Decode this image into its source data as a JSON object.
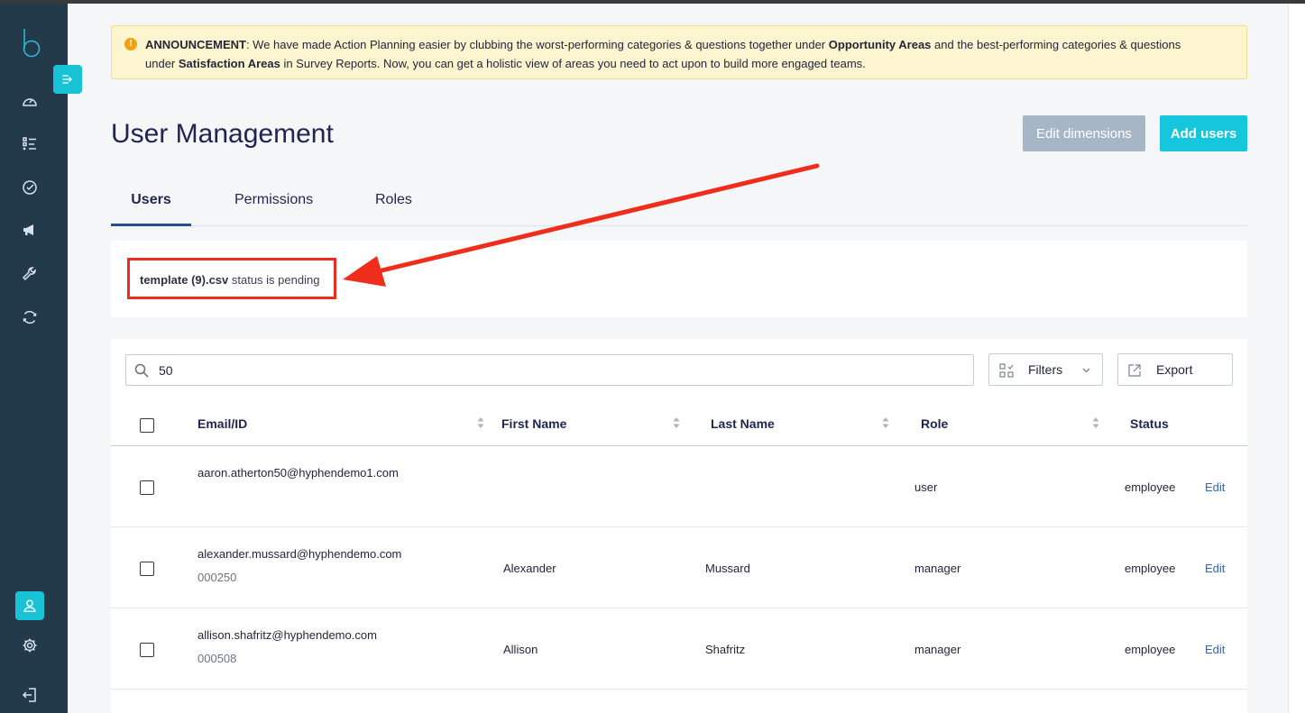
{
  "announcement": {
    "label": "ANNOUNCEMENT",
    "text_1": ": We have made Action Planning easier by clubbing the worst-performing categories & questions  together under ",
    "bold_1": "Opportunity Areas",
    "text_2": " and the best-performing  categories & questions under ",
    "bold_2": "Satisfaction Areas",
    "text_3": " in Survey Reports.  Now, you can get a holistic view of areas you need to act upon to build more engaged teams."
  },
  "page": {
    "title": "User Management",
    "edit_dimensions_label": "Edit dimensions",
    "add_users_label": "Add users"
  },
  "tabs": [
    {
      "label": "Users",
      "active": true
    },
    {
      "label": "Permissions",
      "active": false
    },
    {
      "label": "Roles",
      "active": false
    }
  ],
  "upload_status": {
    "filename": "template (9).csv",
    "message": " status is pending"
  },
  "toolbar": {
    "search_value": "50",
    "filters_label": "Filters",
    "export_label": "Export"
  },
  "table": {
    "columns": [
      "Email/ID",
      "First Name",
      "Last Name",
      "Role",
      "Status"
    ],
    "rows": [
      {
        "email": "aaron.atherton50@hyphendemo1.com",
        "id": "",
        "first_name": "",
        "last_name": "",
        "role": "user",
        "status": "employee",
        "action": "Edit"
      },
      {
        "email": "alexander.mussard@hyphendemo.com",
        "id": "000250",
        "first_name": "Alexander",
        "last_name": "Mussard",
        "role": "manager",
        "status": "employee",
        "action": "Edit"
      },
      {
        "email": "allison.shafritz@hyphendemo.com",
        "id": "000508",
        "first_name": "Allison",
        "last_name": "Shafritz",
        "role": "manager",
        "status": "employee",
        "action": "Edit"
      }
    ]
  },
  "sidebar": {
    "logo_letter": "b",
    "icons": [
      "dashboard-icon",
      "checklist-icon",
      "check-circle-icon",
      "megaphone-icon",
      "wrench-icon",
      "refresh-icon",
      "user-icon",
      "settings-icon",
      "logout-icon"
    ]
  },
  "colors": {
    "sidebar": "#233a4b",
    "accent": "#15c6dc",
    "highlight": "#ee2d1c",
    "link": "#3566b4"
  }
}
